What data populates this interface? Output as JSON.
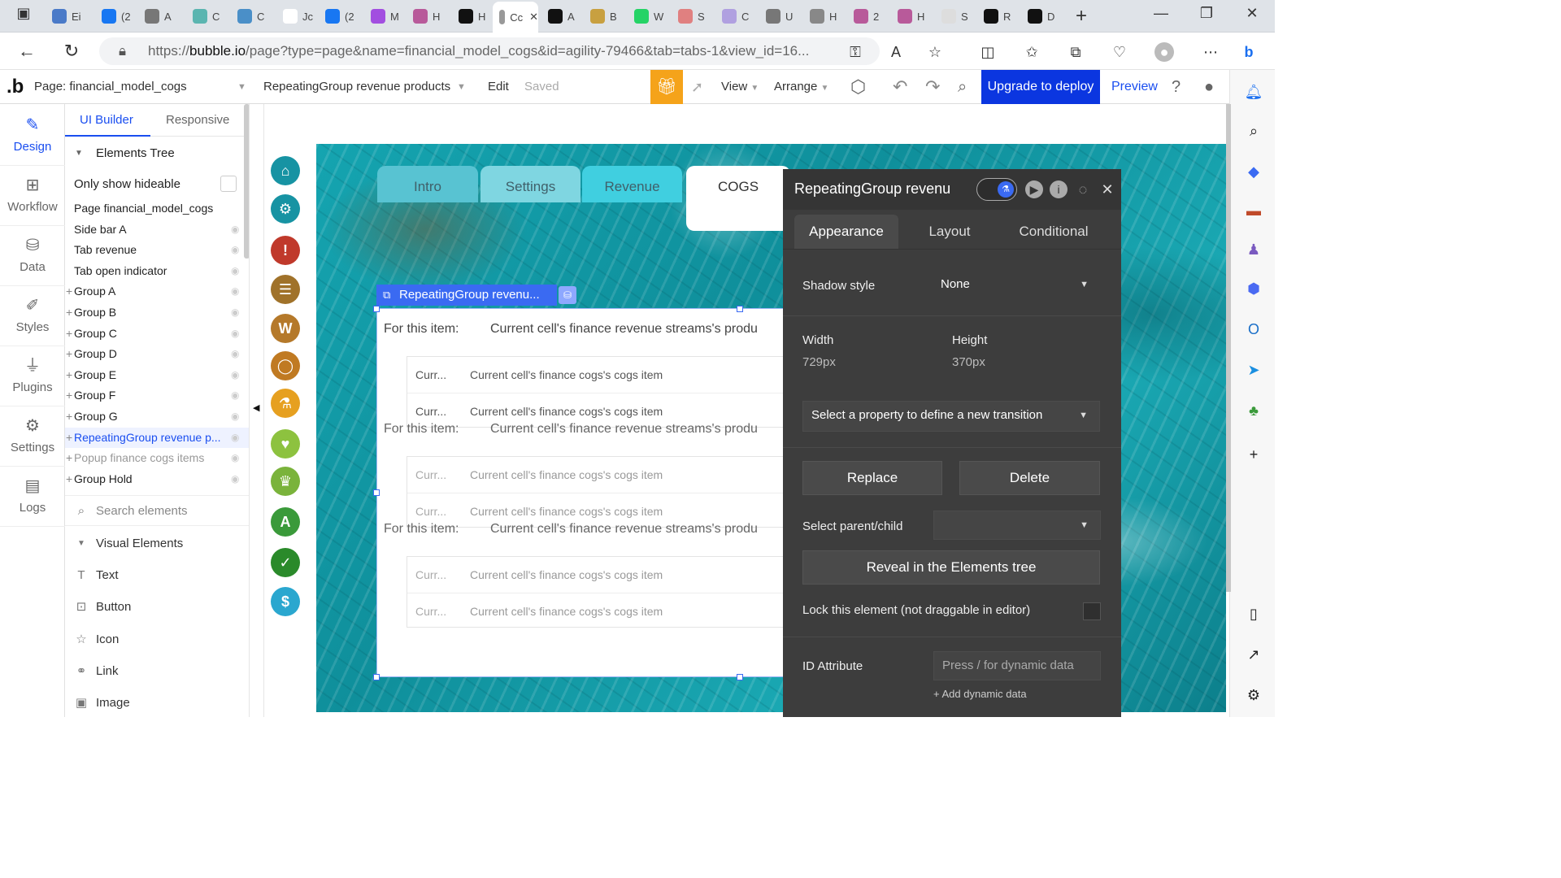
{
  "browser": {
    "tabs": [
      {
        "short": "Ei",
        "color": "#4a7ac8"
      },
      {
        "short": "(2",
        "color": "#1877f2"
      },
      {
        "short": "A",
        "color": "#777"
      },
      {
        "short": "C",
        "color": "#5bb5b0"
      },
      {
        "short": "C",
        "color": "#4a8fc8"
      },
      {
        "short": "Jc",
        "color": "#ffffff"
      },
      {
        "short": "(2",
        "color": "#1877f2"
      },
      {
        "short": "M",
        "color": "#a24ee0"
      },
      {
        "short": "H",
        "color": "#b85a9a"
      },
      {
        "short": "H",
        "color": "#111"
      },
      {
        "short": "Cc",
        "color": "#999"
      },
      {
        "short": "A",
        "color": "#111"
      },
      {
        "short": "B",
        "color": "#c8a040"
      },
      {
        "short": "W",
        "color": "#25d366"
      },
      {
        "short": "S",
        "color": "#e08080"
      },
      {
        "short": "C",
        "color": "#b0a0e0"
      },
      {
        "short": "U",
        "color": "#777"
      },
      {
        "short": "H",
        "color": "#888"
      },
      {
        "short": "2",
        "color": "#b85a9a"
      },
      {
        "short": "H",
        "color": "#b85a9a"
      },
      {
        "short": "S",
        "color": "#ddd"
      },
      {
        "short": "R",
        "color": "#111"
      },
      {
        "short": "D",
        "color": "#111"
      }
    ],
    "url_prefix": "https://",
    "url_domain": "bubble.io",
    "url_rest": "/page?type=page&name=financial_model_cogs&id=agility-79466&tab=tabs-1&view_id=16..."
  },
  "editor": {
    "page_label": "Page: financial_model_cogs",
    "element_select": "RepeatingGroup revenue products",
    "edit": "Edit",
    "saved": "Saved",
    "view": "View",
    "arrange": "Arrange",
    "upgrade": "Upgrade to deploy",
    "preview": "Preview"
  },
  "leftnav": [
    {
      "label": "Design",
      "icon": "✎",
      "active": true
    },
    {
      "label": "Workflow",
      "icon": "⊞"
    },
    {
      "label": "Data",
      "icon": "⛁"
    },
    {
      "label": "Styles",
      "icon": "✐"
    },
    {
      "label": "Plugins",
      "icon": "⏚"
    },
    {
      "label": "Settings",
      "icon": "⚙"
    },
    {
      "label": "Logs",
      "icon": "▤"
    }
  ],
  "tree": {
    "tab_builder": "UI Builder",
    "tab_responsive": "Responsive",
    "section": "Elements Tree",
    "only_hideable": "Only show hideable",
    "items": [
      {
        "label": "Page financial_model_cogs",
        "eye": false
      },
      {
        "label": "Side bar A",
        "eye": true
      },
      {
        "label": "Tab revenue",
        "eye": true
      },
      {
        "label": "Tab open indicator",
        "eye": true
      },
      {
        "label": "Group A",
        "plus": true,
        "eye": true
      },
      {
        "label": "Group B",
        "plus": true,
        "eye": true
      },
      {
        "label": "Group C",
        "plus": true,
        "eye": true
      },
      {
        "label": "Group D",
        "plus": true,
        "eye": true
      },
      {
        "label": "Group E",
        "plus": true,
        "eye": true
      },
      {
        "label": "Group F",
        "plus": true,
        "eye": true
      },
      {
        "label": "Group G",
        "plus": true,
        "eye": true
      },
      {
        "label": "RepeatingGroup revenue p...",
        "plus": true,
        "eye": true,
        "selected": true
      },
      {
        "label": "Popup finance cogs items",
        "plus": true,
        "eye": true,
        "muted": true
      },
      {
        "label": "Group Hold",
        "plus": true,
        "eye": true
      }
    ],
    "search_placeholder": "Search elements",
    "visual_section": "Visual Elements",
    "visual": [
      {
        "label": "Text",
        "icon": "T"
      },
      {
        "label": "Button",
        "icon": "⊡"
      },
      {
        "label": "Icon",
        "icon": "☆"
      },
      {
        "label": "Link",
        "icon": "⚭"
      },
      {
        "label": "Image",
        "icon": "▣"
      }
    ]
  },
  "page_tabs": [
    "Intro",
    "Settings",
    "Revenue",
    "COGS"
  ],
  "icon_column": [
    {
      "name": "home-icon",
      "glyph": "⌂",
      "color": "#1793a3"
    },
    {
      "name": "settings-icon",
      "glyph": "⚙",
      "color": "#1793a3"
    },
    {
      "name": "alert-icon",
      "glyph": "!",
      "color": "#c0392b"
    },
    {
      "name": "list-icon",
      "glyph": "☰",
      "color": "#a0722a"
    },
    {
      "name": "wiki-icon",
      "glyph": "W",
      "color": "#b5792a"
    },
    {
      "name": "chat-icon",
      "glyph": "◯",
      "color": "#c07a22"
    },
    {
      "name": "flask-icon",
      "glyph": "⚗",
      "color": "#e6a020"
    },
    {
      "name": "heart-icon",
      "glyph": "♥",
      "color": "#8dc23f"
    },
    {
      "name": "trophy-icon",
      "glyph": "♛",
      "color": "#7ab33b"
    },
    {
      "name": "ab-icon",
      "glyph": "A",
      "color": "#3a9a3a"
    },
    {
      "name": "check-icon",
      "glyph": "✓",
      "color": "#2a8a2a"
    },
    {
      "name": "dollar-icon",
      "glyph": "$",
      "color": "#2aa7cf"
    }
  ],
  "rg": {
    "label": "RepeatingGroup revenu...",
    "for_item": "For this item:",
    "stream": "Current cell's finance revenue streams's produ",
    "curr": "Curr...",
    "cogs": "Current cell's finance cogs's cogs item"
  },
  "panel": {
    "title": "RepeatingGroup revenu",
    "tabs": [
      "Appearance",
      "Layout",
      "Conditional"
    ],
    "shadow_label": "Shadow style",
    "shadow_value": "None",
    "width_label": "Width",
    "width_value": "729px",
    "height_label": "Height",
    "height_value": "370px",
    "transition": "Select a property to define a new transition",
    "replace": "Replace",
    "delete": "Delete",
    "parent_child": "Select parent/child",
    "reveal": "Reveal in the Elements tree",
    "lock": "Lock this element (not draggable in editor)",
    "id_label": "ID Attribute",
    "id_placeholder": "Press / for dynamic data",
    "add_dynamic": "+ Add dynamic data"
  }
}
